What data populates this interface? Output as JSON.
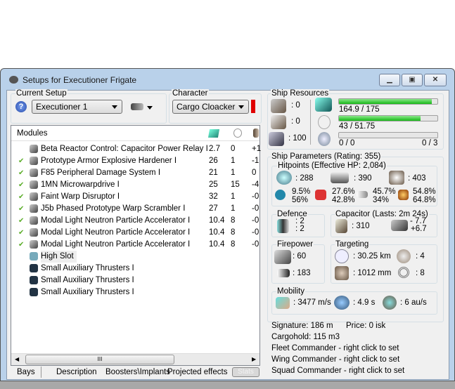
{
  "window": {
    "title": "Setups for Executioner Frigate",
    "buttons": [
      "minimize",
      "maximize",
      "close"
    ]
  },
  "setup": {
    "label": "Current Setup",
    "value": "Executioner 1"
  },
  "character": {
    "label": "Character",
    "value": "Cargo Cloacker",
    "status_color": "#e00000"
  },
  "modules": {
    "header": "Modules",
    "columns": [
      "cpu-icon",
      "powergrid-icon",
      "capacitor-icon"
    ],
    "rows": [
      {
        "checked": false,
        "name": "Beta Reactor Control: Capacitor Power Relay I",
        "c1": "2.7",
        "c2": "0",
        "c3": "+1"
      },
      {
        "checked": true,
        "name": "Prototype Armor Explosive Hardener I",
        "c1": "26",
        "c2": "1",
        "c3": "-1"
      },
      {
        "checked": true,
        "name": "F85 Peripheral Damage System I",
        "c1": "21",
        "c2": "1",
        "c3": "0"
      },
      {
        "checked": true,
        "name": "1MN Microwarpdrive I",
        "c1": "25",
        "c2": "15",
        "c3": "-4"
      },
      {
        "checked": true,
        "name": "Faint Warp Disruptor I",
        "c1": "32",
        "c2": "1",
        "c3": "-0"
      },
      {
        "checked": true,
        "name": "J5b Phased Prototype Warp Scrambler I",
        "c1": "27",
        "c2": "1",
        "c3": "-0"
      },
      {
        "checked": true,
        "name": "Modal Light Neutron Particle Accelerator I",
        "c1": "10.4",
        "c2": "8",
        "c3": "-0"
      },
      {
        "checked": true,
        "name": "Modal Light Neutron Particle Accelerator I",
        "c1": "10.4",
        "c2": "8",
        "c3": "-0"
      },
      {
        "checked": true,
        "name": "Modal Light Neutron Particle Accelerator I",
        "c1": "10.4",
        "c2": "8",
        "c3": "-0"
      },
      {
        "checked": false,
        "name": "High Slot",
        "c1": "",
        "c2": "",
        "c3": ""
      },
      {
        "checked": false,
        "name": "Small Auxiliary Thrusters I",
        "c1": "",
        "c2": "",
        "c3": ""
      },
      {
        "checked": false,
        "name": "Small Auxiliary Thrusters I",
        "c1": "",
        "c2": "",
        "c3": ""
      },
      {
        "checked": false,
        "name": "Small Auxiliary Thrusters I",
        "c1": "",
        "c2": "",
        "c3": ""
      }
    ],
    "scroll_grip": "III"
  },
  "tabs": [
    "Bays",
    "Description",
    "Boosters\\Implants",
    "Projected effects",
    "Stats"
  ],
  "resources": {
    "label": "Ship Resources",
    "turrets": ": 0",
    "launchers": ": 0",
    "calibration": ": 100",
    "cpu": {
      "text": "164.9 / 175",
      "fraction": 0.942
    },
    "powergrid": {
      "text": "43 / 51.75",
      "fraction": 0.831
    },
    "drones": {
      "text": "0 / 0",
      "text_right": "0 / 3",
      "fraction": 0
    }
  },
  "params": {
    "label": "Ship Parameters (Rating: 355)",
    "hitpoints": {
      "label": "Hitpoints (Effective HP: 2,084)",
      "shield": ": 288",
      "armor": ": 390",
      "structure": ": 403",
      "resists": [
        {
          "a": "9.5%",
          "b": "56%"
        },
        {
          "a": "27.6%",
          "b": "42.8%"
        },
        {
          "a": "45.7%",
          "b": "34%"
        },
        {
          "a": "54.8%",
          "b": "64.8%"
        }
      ]
    },
    "defence": {
      "label": "Defence",
      "a": ": 2",
      "b": ": 2"
    },
    "capacitor": {
      "label": "Capacitor (Lasts: 2m 24s)",
      "amount": ": 310",
      "use": "- 7.7",
      "recharge": "+6.7"
    },
    "firepower": {
      "label": "Firepower",
      "dps": ": 60",
      "volley": ": 183"
    },
    "targeting": {
      "label": "Targeting",
      "range": ": 30.25 km",
      "targets": ": 4",
      "resolution": ": 1012 mm",
      "sensor": ": 8"
    },
    "mobility": {
      "label": "Mobility",
      "speed": ": 3477 m/s",
      "align": ": 4.9 s",
      "warp": ": 6 au/s"
    }
  },
  "info": {
    "signature": "Signature: 186 m",
    "price": "Price: 0 isk",
    "cargo": "Cargohold: 115 m3",
    "fleet": "Fleet Commander - right click to set",
    "wing": "Wing Commander - right click to set",
    "squad": "Squad Commander - right click to set"
  }
}
